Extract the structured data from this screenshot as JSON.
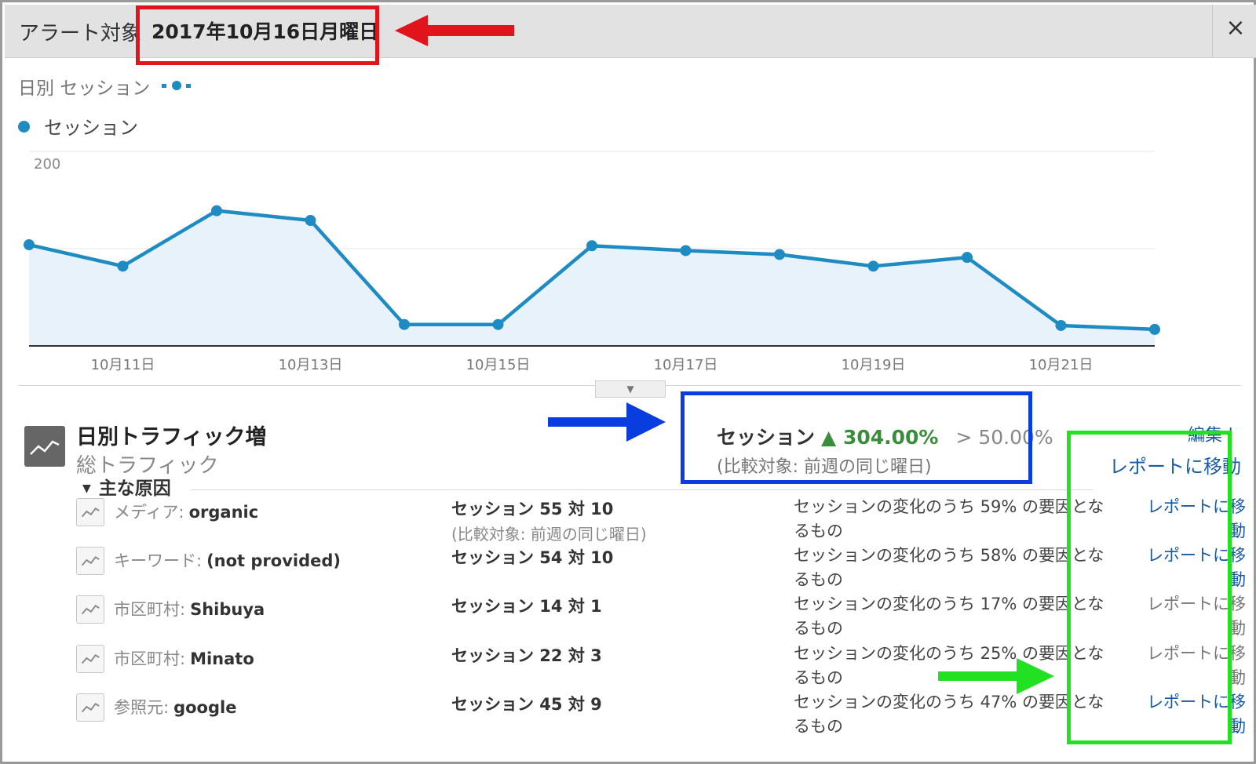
{
  "header": {
    "label": "アラート対象",
    "date": "2017年10月16日月曜日",
    "close_glyph": "×"
  },
  "chart": {
    "title": "日別 セッション",
    "legend_label": "セッション",
    "color": "#1e8bc3"
  },
  "chart_data": {
    "type": "area",
    "x": [
      "10月10日",
      "10月11日",
      "10月12日",
      "10月13日",
      "10月14日",
      "10月15日",
      "10月16日",
      "10月17日",
      "10月18日",
      "10月19日",
      "10月20日",
      "10月21日",
      "10月22日"
    ],
    "series": [
      {
        "name": "セッション",
        "values": [
          104,
          82,
          139,
          129,
          22,
          22,
          103,
          98,
          94,
          82,
          91,
          21,
          17
        ]
      }
    ],
    "x_tick_labels": [
      "10月11日",
      "10月13日",
      "10月15日",
      "10月17日",
      "10月19日",
      "10月21日"
    ],
    "y_ticks": [
      100,
      200
    ],
    "ylim": [
      0,
      200
    ],
    "grid": true
  },
  "alert": {
    "name": "日別トラフィック増",
    "subtitle": "総トラフィック",
    "metric_name": "セッション",
    "metric_change": "▲ 304.00%",
    "threshold": "> 50.00%",
    "comparison": "(比較対象: 前週の同じ曜日)",
    "edit_label": "編集 |",
    "report_link": "レポートに移動"
  },
  "causes": {
    "header": "主な原因",
    "rows": [
      {
        "dim_label": "メディア:",
        "dim_value": "organic",
        "sessions": "セッション 55 対 10",
        "compare": "(比較対象: 前週の同じ曜日)",
        "share": "セッションの変化のうち 59% の要因となるもの",
        "link": "レポートに移動",
        "link_active": true
      },
      {
        "dim_label": "キーワード:",
        "dim_value": "(not provided)",
        "sessions": "セッション 54 対 10",
        "compare": "",
        "share": "セッションの変化のうち 58% の要因となるもの",
        "link": "レポートに移動",
        "link_active": true
      },
      {
        "dim_label": "市区町村:",
        "dim_value": "Shibuya",
        "sessions": "セッション 14 対 1",
        "compare": "",
        "share": "セッションの変化のうち 17% の要因となるもの",
        "link": "レポートに移動",
        "link_active": false
      },
      {
        "dim_label": "市区町村:",
        "dim_value": "Minato",
        "sessions": "セッション 22 対 3",
        "compare": "",
        "share": "セッションの変化のうち 25% の要因となるもの",
        "link": "レポートに移動",
        "link_active": false
      },
      {
        "dim_label": "参照元:",
        "dim_value": "google",
        "sessions": "セッション 45 対 9",
        "compare": "",
        "share": "セッションの変化のうち 47% の要因となるもの",
        "link": "レポートに移動",
        "link_active": true
      }
    ]
  },
  "colors": {
    "link": "#1a5aa3",
    "link_inactive": "#777777",
    "positive": "#3a8d3a",
    "annotation_red": "#e0141a",
    "annotation_blue": "#0a3de0",
    "annotation_green": "#22e022"
  }
}
